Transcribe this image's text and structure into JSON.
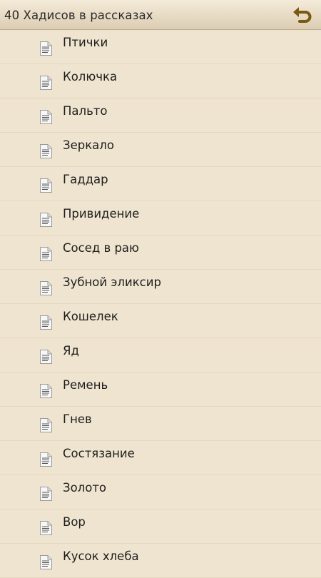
{
  "header": {
    "title": "40 Хадисов в рассказах",
    "back_icon": "undo-arrow-icon",
    "accent": "#7a5a12"
  },
  "list": {
    "item_icon": "document-icon",
    "items": [
      {
        "label": "Птички"
      },
      {
        "label": "Колючка"
      },
      {
        "label": "Пальто"
      },
      {
        "label": "Зеркало"
      },
      {
        "label": "Гаддар"
      },
      {
        "label": "Привидение"
      },
      {
        "label": "Сосед в раю"
      },
      {
        "label": "Зубной эликсир"
      },
      {
        "label": "Кошелек"
      },
      {
        "label": "Яд"
      },
      {
        "label": "Ремень"
      },
      {
        "label": "Гнев"
      },
      {
        "label": "Состязание"
      },
      {
        "label": "Золото"
      },
      {
        "label": "Вор"
      },
      {
        "label": "Кусок хлеба"
      }
    ]
  }
}
